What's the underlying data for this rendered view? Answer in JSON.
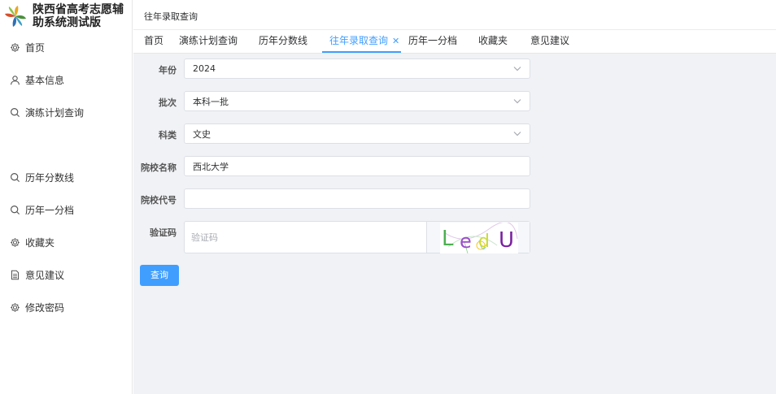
{
  "app": {
    "title_line1": "陕西省高考志愿辅",
    "title_line2": "助系统测试版"
  },
  "sidebar": {
    "items": [
      {
        "label": "首页",
        "icon": "gear-icon"
      },
      {
        "label": "基本信息",
        "icon": "user-icon"
      },
      {
        "label": "演练计划查询",
        "icon": "search-icon"
      },
      {
        "label": "历年分数线",
        "icon": "search-icon"
      },
      {
        "label": "历年一分档",
        "icon": "search-icon"
      },
      {
        "label": "收藏夹",
        "icon": "gear-icon"
      },
      {
        "label": "意见建议",
        "icon": "document-icon"
      },
      {
        "label": "修改密码",
        "icon": "gear-icon"
      }
    ]
  },
  "header": {
    "breadcrumb": "往年录取查询"
  },
  "tabs": [
    {
      "label": "首页"
    },
    {
      "label": "演练计划查询"
    },
    {
      "label": "历年分数线"
    },
    {
      "label": "往年录取查询",
      "active": true,
      "close": "✕"
    },
    {
      "label": "历年一分档"
    },
    {
      "label": "收藏夹"
    },
    {
      "label": "意见建议"
    }
  ],
  "form": {
    "year": {
      "label": "年份",
      "value": "2024"
    },
    "batch": {
      "label": "批次",
      "value": "本科一批"
    },
    "subject": {
      "label": "科类",
      "value": "文史"
    },
    "school_name": {
      "label": "院校名称",
      "value": "西北大学"
    },
    "school_code": {
      "label": "院校代号",
      "value": ""
    },
    "captcha": {
      "label": "验证码",
      "placeholder": "验证码",
      "image_text": "LedU"
    },
    "query_button": "查询"
  },
  "colors": {
    "primary": "#409eff",
    "background": "#f0f2f5"
  }
}
